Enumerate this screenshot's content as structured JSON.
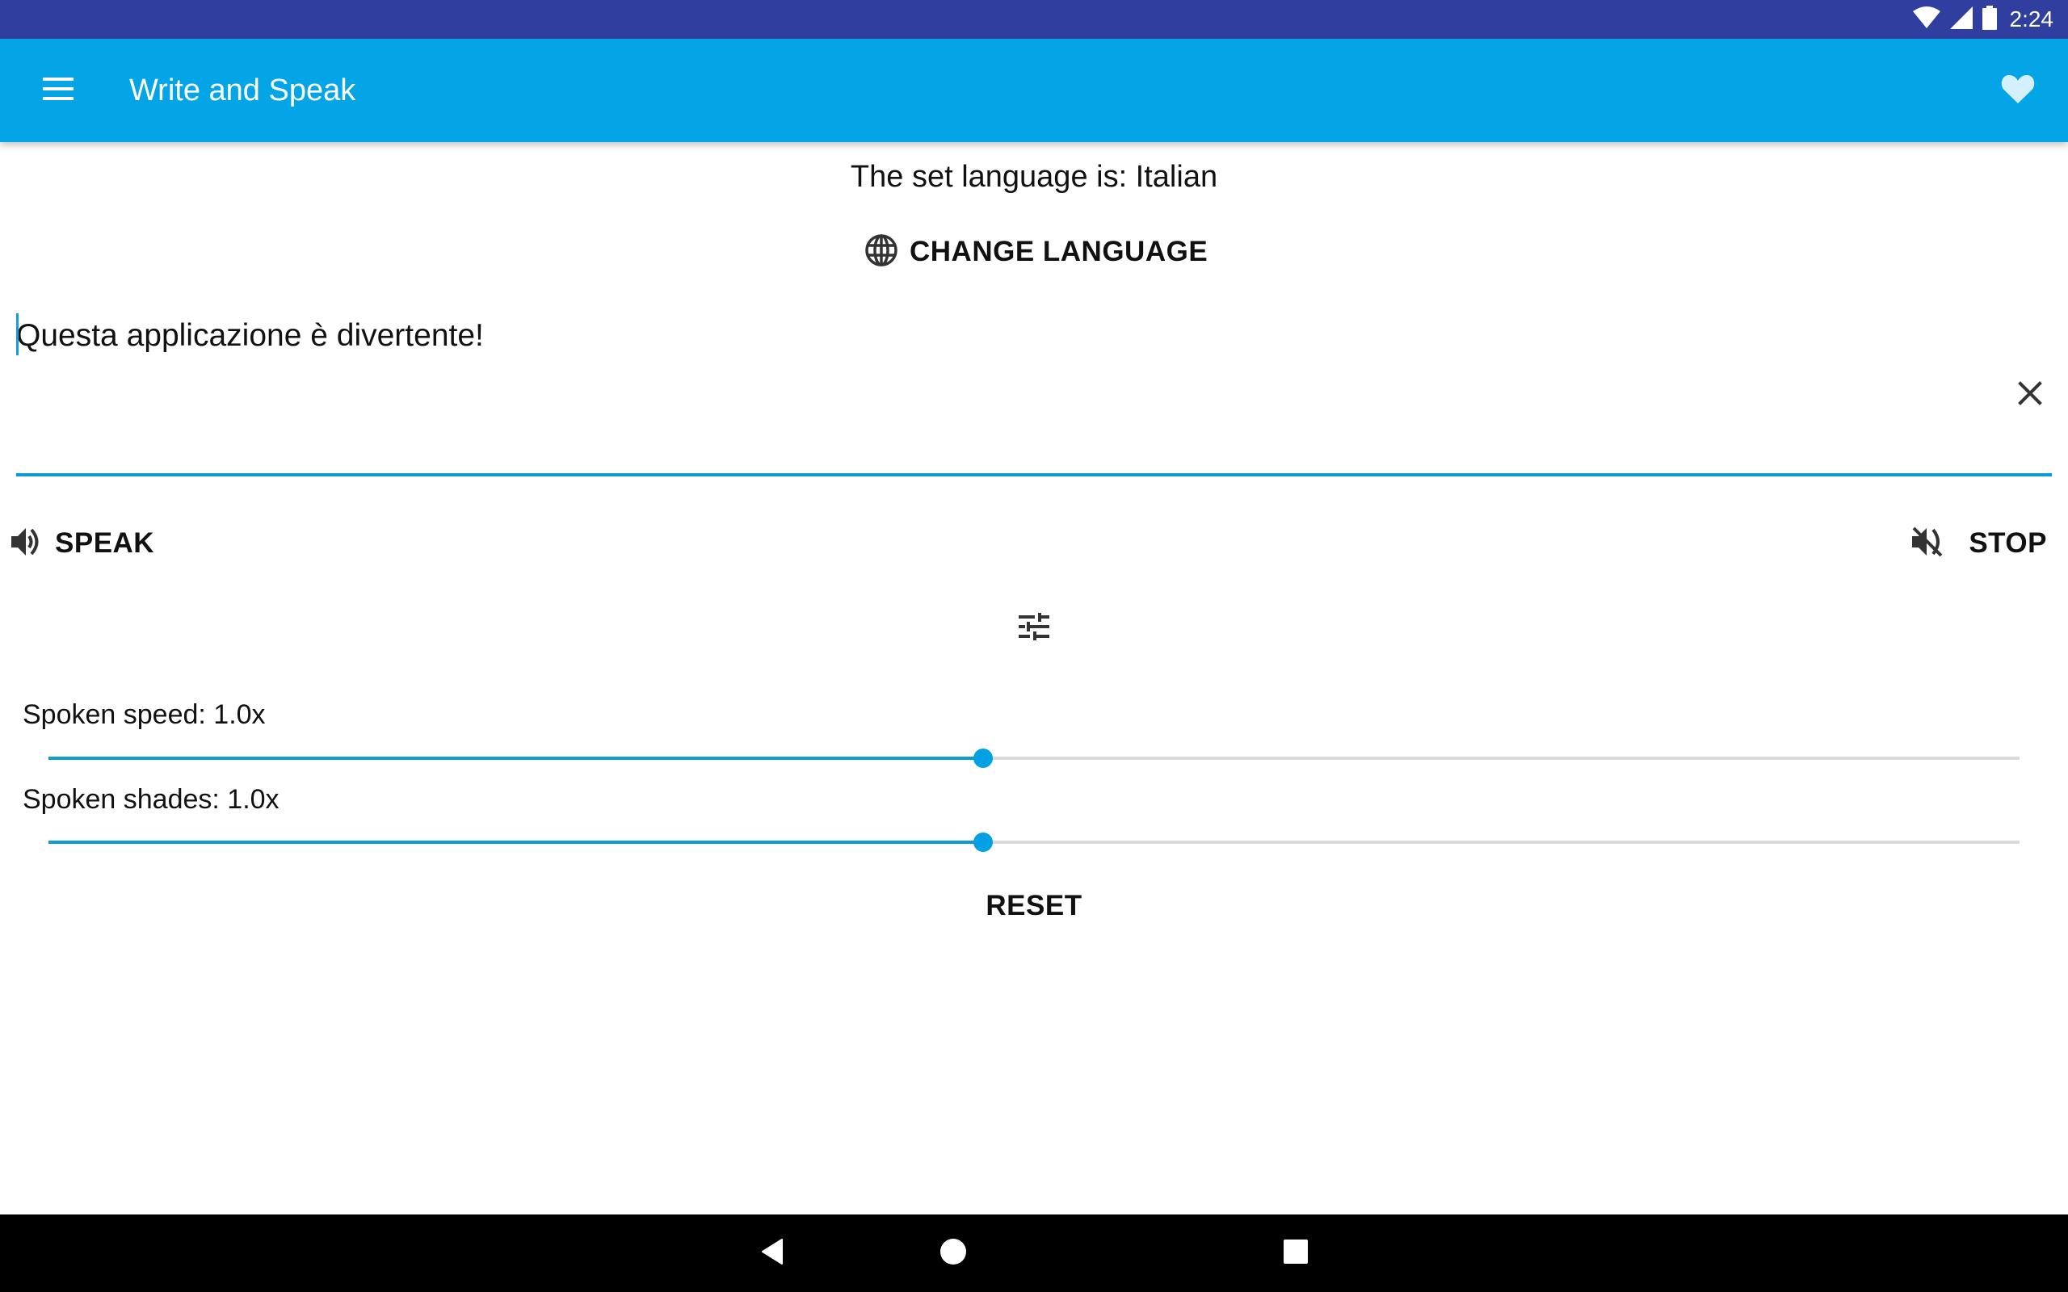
{
  "status_bar": {
    "time": "2:24",
    "icons": [
      "wifi-icon",
      "cell-signal-icon",
      "battery-icon"
    ],
    "background": "#303F9F"
  },
  "toolbar": {
    "title": "Write and Speak",
    "menu_icon": "hamburger-menu-icon",
    "favorite_icon": "heart-icon",
    "background": "#03A5E6"
  },
  "language": {
    "label": "The set language is:  Italian",
    "change_button_label": "CHANGE LANGUAGE",
    "change_button_icon": "globe-icon"
  },
  "text_input": {
    "value": "Questa applicazione è divertente!",
    "clear_icon": "close-icon",
    "accent_color": "#0A9BD9"
  },
  "actions": {
    "speak_label": "SPEAK",
    "speak_icon": "volume-up-icon",
    "stop_label": "STOP",
    "stop_icon": "volume-off-icon",
    "settings_icon": "tune-icon"
  },
  "sliders": [
    {
      "label": "Spoken speed:  1.0x",
      "value_text": "1.0x",
      "position_fraction": 0.474
    },
    {
      "label": "Spoken shades: 1.0x",
      "value_text": "1.0x",
      "position_fraction": 0.474
    }
  ],
  "reset_label": "RESET",
  "nav_bar": {
    "buttons": [
      "back-icon",
      "home-icon",
      "recents-icon"
    ]
  }
}
